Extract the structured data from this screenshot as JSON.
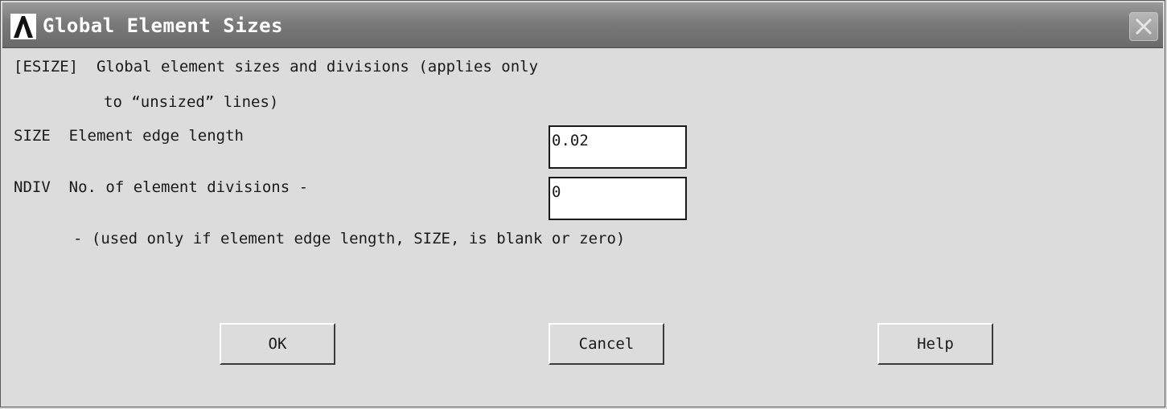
{
  "window": {
    "title": "Global Element Sizes"
  },
  "icons": {
    "app": "ansys-logo-icon",
    "close": "close-icon"
  },
  "content": {
    "line1": "[ESIZE]  Global element sizes and divisions (applies only",
    "line2": "to “unsized” lines)",
    "size_label": "SIZE  Element edge length",
    "size_value": "0.02",
    "ndiv_label": "NDIV  No. of element divisions -",
    "ndiv_value": "0",
    "note": "- (used only if element edge length, SIZE, is blank or zero)"
  },
  "buttons": {
    "ok": "OK",
    "cancel": "Cancel",
    "help": "Help"
  }
}
